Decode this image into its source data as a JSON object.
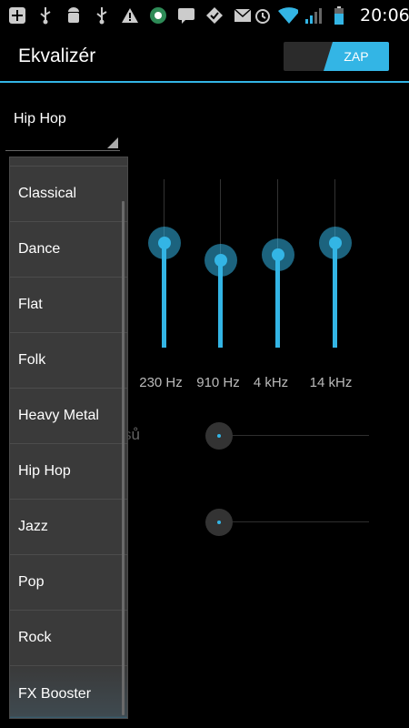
{
  "status_bar": {
    "time": "20:06",
    "left_icons": [
      "add-icon",
      "usb-icon",
      "android-debug-icon",
      "usb-icon",
      "warning-icon",
      "sync-app-icon",
      "chat-icon",
      "check-badge-icon",
      "email-icon"
    ],
    "right_icons": [
      "alarm-icon",
      "wifi-icon",
      "signal-icon",
      "battery-icon"
    ]
  },
  "action_bar": {
    "title": "Ekvalizér",
    "toggle_label": "ZAP",
    "toggle_on": true
  },
  "preset_spinner": {
    "value": "Hip Hop"
  },
  "equalizer": {
    "bands": [
      {
        "label": "230 Hz",
        "level": 0.62
      },
      {
        "label": "910 Hz",
        "level": 0.52
      },
      {
        "label": "4 kHz",
        "level": 0.55
      },
      {
        "label": "14 kHz",
        "level": 0.62
      }
    ]
  },
  "effects": {
    "label_fragment": "sů",
    "sliders": [
      {
        "value": 0
      },
      {
        "value": 0
      }
    ]
  },
  "dropdown": {
    "items": [
      "Classical",
      "Dance",
      "Flat",
      "Folk",
      "Heavy Metal",
      "Hip Hop",
      "Jazz",
      "Pop",
      "Rock",
      "FX Booster"
    ]
  },
  "colors": {
    "accent": "#33b5e5",
    "background": "#000000",
    "dropdown_bg": "#3a3a3a"
  }
}
